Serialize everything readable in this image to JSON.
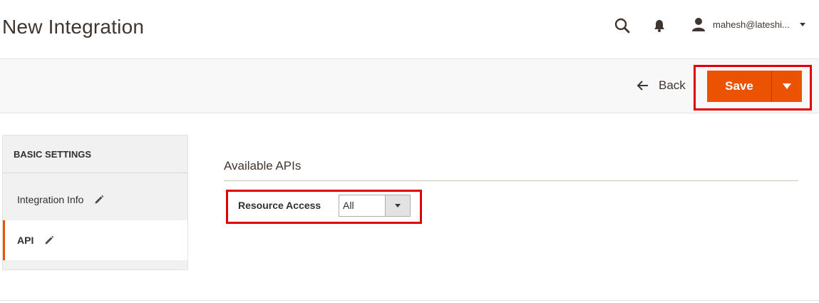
{
  "header": {
    "title": "New Integration",
    "user_name": "mahesh@lateshi...",
    "icons": {
      "search": "search-icon",
      "notifications": "bell-icon",
      "user": "user-icon"
    }
  },
  "actions": {
    "back_label": "Back",
    "save_label": "Save"
  },
  "sidebar": {
    "title": "BASIC SETTINGS",
    "items": [
      {
        "label": "Integration Info",
        "active": false
      },
      {
        "label": "API",
        "active": true
      }
    ]
  },
  "main": {
    "section_title": "Available APIs",
    "resource_access": {
      "label": "Resource Access",
      "value": "All"
    }
  },
  "colors": {
    "accent": "#eb5202",
    "highlight": "#e00000"
  }
}
